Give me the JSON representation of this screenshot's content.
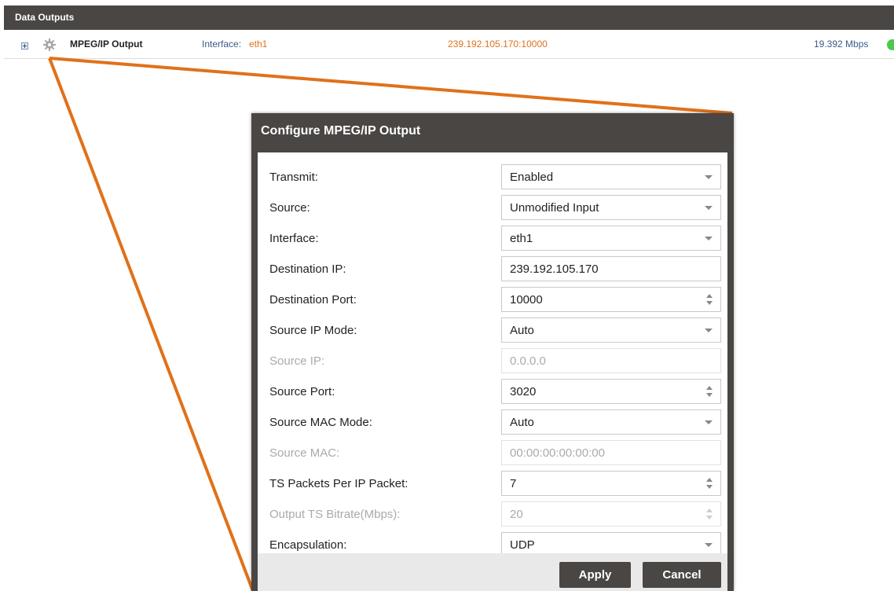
{
  "header": {
    "title": "Data Outputs"
  },
  "output_row": {
    "name": "MPEG/IP Output",
    "interface_label": "Interface:",
    "interface_value": "eth1",
    "address": "239.192.105.170:10000",
    "bitrate": "19.392  Mbps",
    "status_color": "#4cc84c",
    "icons": [
      "expand-icon",
      "gear-icon",
      "status-dot-icon"
    ]
  },
  "dialog": {
    "title": "Configure MPEG/IP Output",
    "fields": [
      {
        "label": "Transmit:",
        "value": "Enabled",
        "type": "select",
        "enabled": true
      },
      {
        "label": "Source:",
        "value": "Unmodified Input",
        "type": "select",
        "enabled": true
      },
      {
        "label": "Interface:",
        "value": "eth1",
        "type": "select",
        "enabled": true
      },
      {
        "label": "Destination IP:",
        "value": "239.192.105.170",
        "type": "text",
        "enabled": true
      },
      {
        "label": "Destination Port:",
        "value": "10000",
        "type": "number",
        "enabled": true
      },
      {
        "label": "Source IP Mode:",
        "value": "Auto",
        "type": "select",
        "enabled": true
      },
      {
        "label": "Source IP:",
        "value": "0.0.0.0",
        "type": "text",
        "enabled": false
      },
      {
        "label": "Source Port:",
        "value": "3020",
        "type": "number",
        "enabled": true
      },
      {
        "label": "Source MAC Mode:",
        "value": "Auto",
        "type": "select",
        "enabled": true
      },
      {
        "label": "Source MAC:",
        "value": "00:00:00:00:00:00",
        "type": "text",
        "enabled": false
      },
      {
        "label": "TS Packets Per IP Packet:",
        "value": "7",
        "type": "number",
        "enabled": true
      },
      {
        "label": "Output TS Bitrate(Mbps):",
        "value": "20",
        "type": "number",
        "enabled": false
      },
      {
        "label": "Encapsulation:",
        "value": "UDP",
        "type": "select",
        "enabled": true
      }
    ],
    "apply_label": "Apply",
    "cancel_label": "Cancel"
  },
  "colors": {
    "header_bg": "#4a4643",
    "accent_orange": "#e0711a",
    "label_blue": "#3b5a8a",
    "status_green": "#4cc84c"
  }
}
